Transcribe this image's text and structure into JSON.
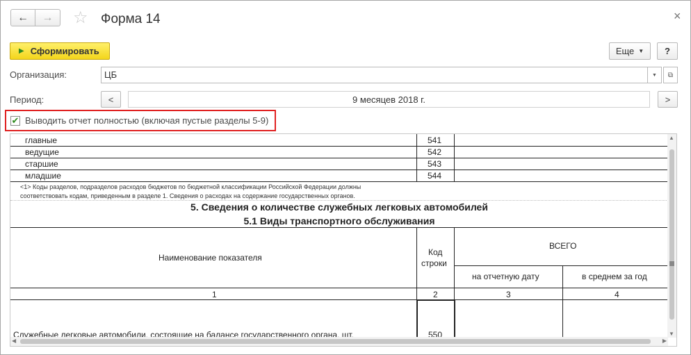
{
  "window": {
    "title": "Форма 14",
    "back_icon": "arrow-left-icon",
    "forward_icon": "arrow-right-icon",
    "favorite_icon": "star-icon",
    "close_icon": "close-icon"
  },
  "toolbar": {
    "generate_label": "Сформировать",
    "more_label": "Еще",
    "help_label": "?"
  },
  "fields": {
    "organization_label": "Организация:",
    "organization_value": "ЦБ",
    "period_label": "Период:",
    "period_value": "9 месяцев 2018 г.",
    "prev_label": "<",
    "next_label": ">"
  },
  "checkbox": {
    "checked": true,
    "label": "Выводить отчет полностью (включая пустые разделы 5-9)"
  },
  "report": {
    "top_rows": [
      {
        "name": "главные",
        "code": "541"
      },
      {
        "name": "ведущие",
        "code": "542"
      },
      {
        "name": "старшие",
        "code": "543"
      },
      {
        "name": "младшие",
        "code": "544"
      }
    ],
    "footnote_line1": "<1> Коды разделов, подразделов расходов бюджетов по бюджетной классификации Российской Федерации должны",
    "footnote_line2": "соответствовать кодам, приведенным в разделе 1. Сведения о расходах на содержание государственных органов.",
    "section_title": "5. Сведения о количестве служебных легковых автомобилей",
    "subsection_title": "5.1 Виды транспортного обслуживания",
    "header": {
      "indicator": "Наименование показателя",
      "code_line1": "Код",
      "code_line2": "строки",
      "total": "ВСЕГО",
      "on_date": "на отчетную дату",
      "average": "в среднем за год"
    },
    "col_numbers": [
      "1",
      "2",
      "3",
      "4"
    ],
    "data_row": {
      "name": "Служебные легковые автомобили, состоящие на балансе государственного органа, шт.",
      "code": "550"
    }
  }
}
